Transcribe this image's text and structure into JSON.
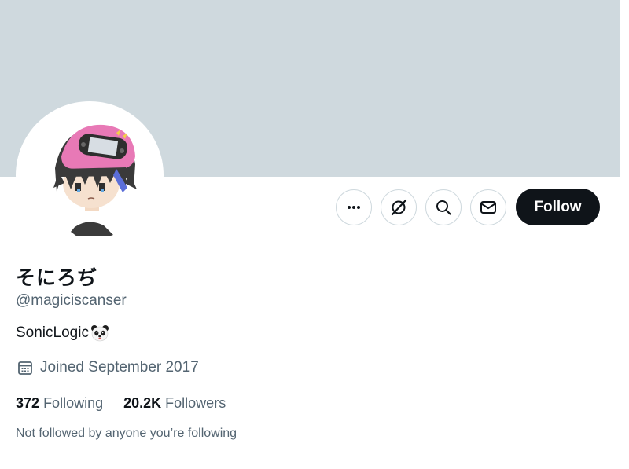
{
  "profile": {
    "display_name": "そにろぢ",
    "handle": "@magiciscanser",
    "bio": "SonicLogic",
    "bio_emoji": "panda-emoji",
    "joined": "Joined September 2017"
  },
  "stats": {
    "following_count": "372",
    "following_label": "Following",
    "followers_count": "20.2K",
    "followers_label": "Followers"
  },
  "social_context": "Not followed by anyone you’re following",
  "actions": {
    "more_icon": "more-icon",
    "grok_icon": "grok-icon",
    "search_icon": "search-icon",
    "message_icon": "message-icon",
    "follow_label": "Follow"
  },
  "colors": {
    "banner": "#cfd9de",
    "primary_text": "#0f1419",
    "secondary_text": "#536471",
    "follow_button": "#0f1419"
  }
}
